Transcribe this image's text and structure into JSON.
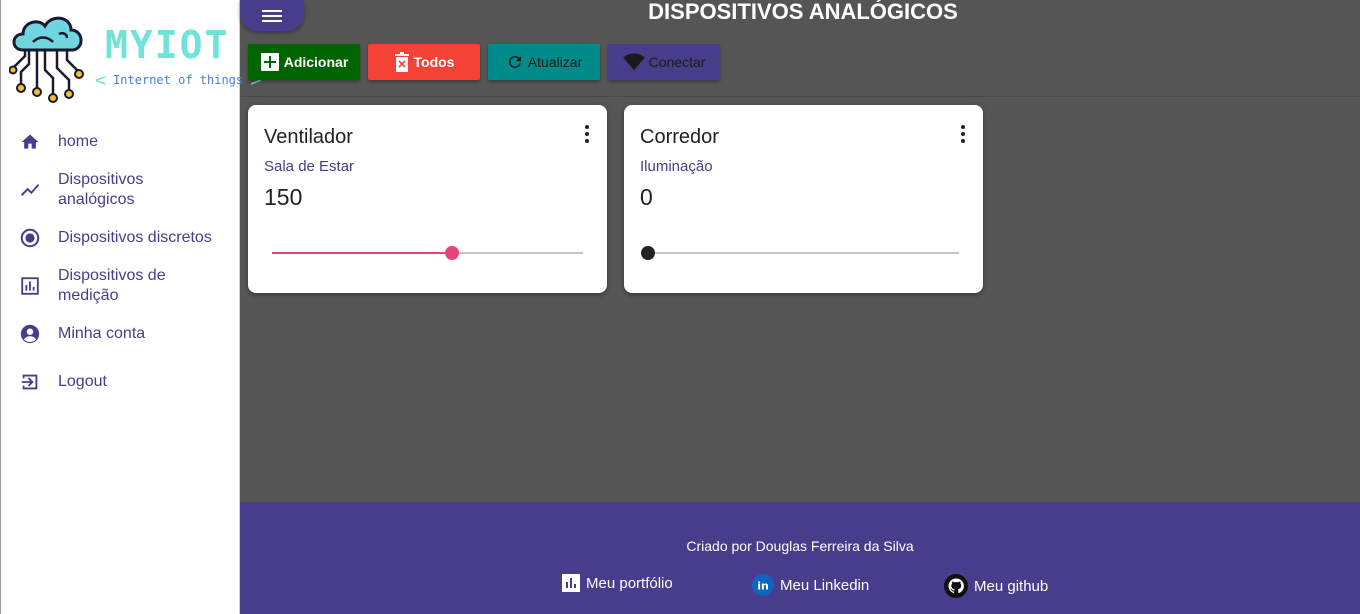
{
  "brand": {
    "name": "MYIOT",
    "tagline": "Internet of things",
    "logo_icon": "cloud-circuit-logo"
  },
  "sidebar": {
    "items": [
      {
        "label": "home",
        "icon": "home-icon"
      },
      {
        "label": "Dispositivos analógicos",
        "icon": "trending-line-icon"
      },
      {
        "label": "Dispositivos discretos",
        "icon": "radio-button-icon"
      },
      {
        "label": "Dispositivos de medição",
        "icon": "bar-chart-icon"
      },
      {
        "label": "Minha conta",
        "icon": "account-circle-icon"
      },
      {
        "label": "Logout",
        "icon": "logout-icon"
      }
    ]
  },
  "header": {
    "title": "DISPOSITIVOS ANALÓGICOS",
    "menu_icon": "hamburger-icon"
  },
  "toolbar": {
    "add_label": "Adicionar",
    "delete_all_label": "Todos",
    "refresh_label": "Atualizar",
    "connect_label": "Conectar"
  },
  "devices": [
    {
      "name": "Ventilador",
      "location": "Sala de Estar",
      "value": "150",
      "level_fraction": 0.58,
      "accent": "#ec407a"
    },
    {
      "name": "Corredor",
      "location": "Iluminação",
      "value": "0",
      "level_fraction": 0.0,
      "accent": "#222222"
    }
  ],
  "footer": {
    "credit": "Criado por Douglas Ferreira da Silva",
    "links": [
      {
        "label": "Meu portfólio",
        "icon": "bar-chart-icon"
      },
      {
        "label": "Meu Linkedin",
        "icon": "linkedin-icon"
      },
      {
        "label": "Meu github",
        "icon": "github-icon"
      }
    ]
  },
  "colors": {
    "primary": "#483d8b",
    "background": "#555555",
    "add": "#006400",
    "delete": "#f44336",
    "refresh": "#008b8b"
  }
}
